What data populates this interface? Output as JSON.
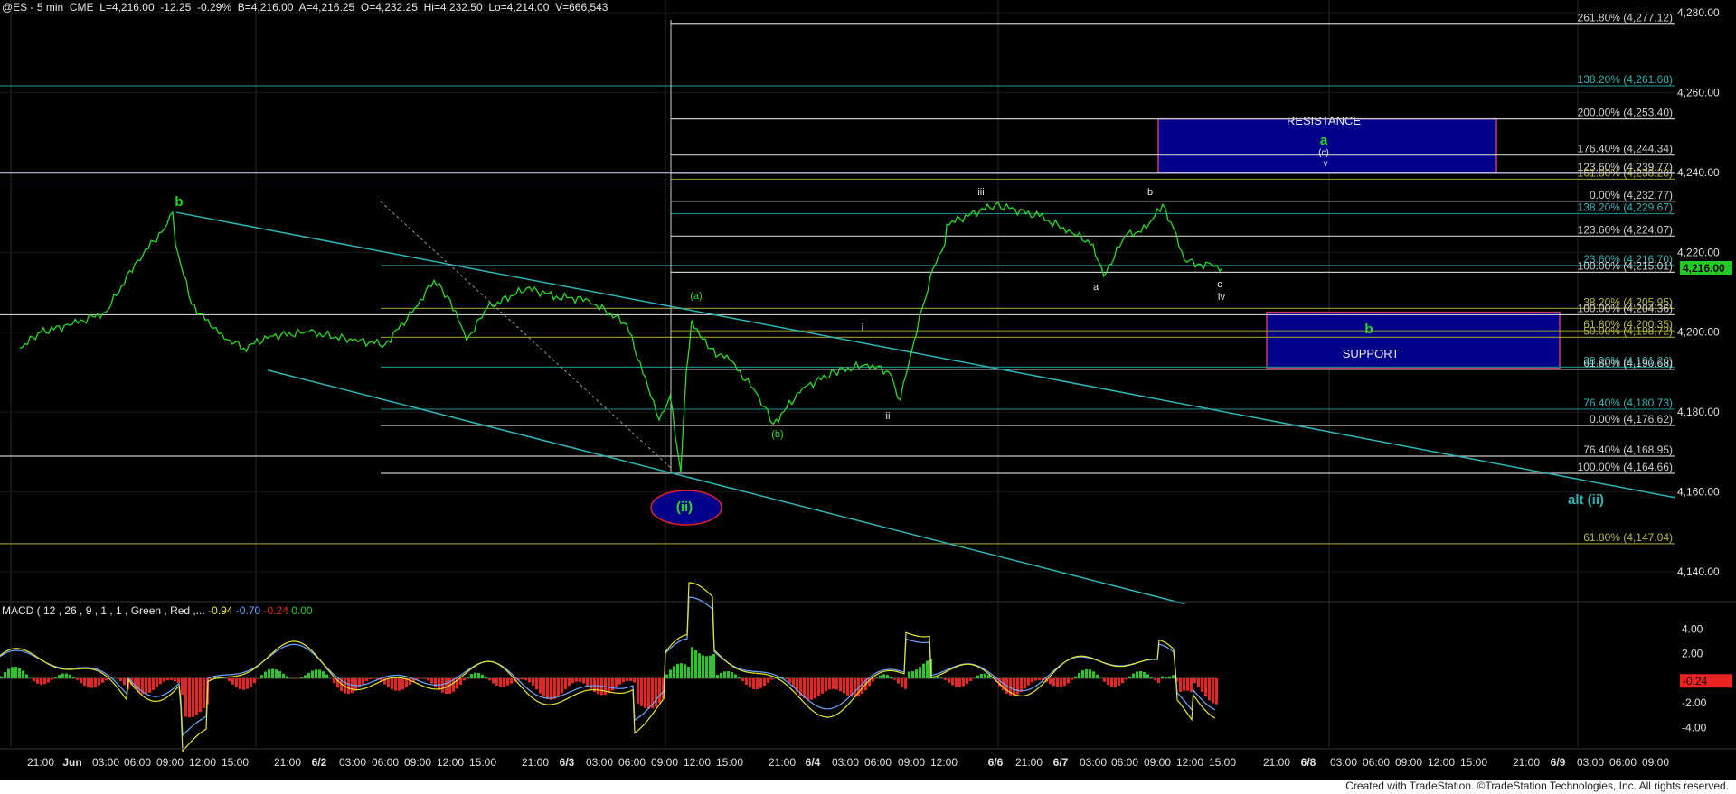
{
  "header": {
    "symbol": "@ES - 5 min",
    "exchange": "CME",
    "last": "L=4,216.00",
    "change": "-12.25",
    "change_pct": "-0.29%",
    "bid": "B=4,216.00",
    "ask": "A=4,216.25",
    "open": "O=4,232.25",
    "high": "Hi=4,232.50",
    "low": "Lo=4,214.00",
    "volume": "V=666,543"
  },
  "macd_header": {
    "label": "MACD ( 12 , 26 , 9 , 1 , 1 , Green , Red ,...",
    "v1": "-0.94",
    "v2": "-0.70",
    "v3": "-0.24",
    "v4": "0.00"
  },
  "last_price_tag": "4,216.00",
  "macd_value_tag": "-0.24",
  "footer": "Created with TradeStation. ©TradeStation Technologies, Inc. All rights reserved.",
  "zones": {
    "resistance": "RESISTANCE",
    "support": "SUPPORT"
  },
  "wave_labels": {
    "b_left": "b",
    "ii_circle": "(ii)",
    "a_paren": "(a)",
    "b_paren": "(b)",
    "i": "i",
    "ii": "ii",
    "iii": "iii",
    "a": "a",
    "b": "b",
    "c": "c",
    "iv": "iv",
    "a_green": "a",
    "c_paren": "(c)",
    "v": "v",
    "b_green": "b",
    "alt_ii": "alt (ii)"
  },
  "colors": {
    "price": "#22dd22",
    "trend": "#2fb5b5",
    "fib_white": "#d8d8d8",
    "fib_teal": "#2aa0a0",
    "fib_olive": "#9a9a3a",
    "zone": "#00008b",
    "macd_yellow": "#e6e62a",
    "macd_blue": "#6aa8ff",
    "hist_up": "#22cc22",
    "hist_down": "#ee2222"
  },
  "chart_data": {
    "type": "line",
    "series": [
      {
        "name": "@ES - 5 min",
        "points": [
          [
            "5/31 19:00",
            4196
          ],
          [
            "5/31 21:00",
            4200
          ],
          [
            "6/1 00:00",
            4202
          ],
          [
            "6/1 03:00",
            4205
          ],
          [
            "6/1 06:00",
            4218
          ],
          [
            "6/1 08:30",
            4226
          ],
          [
            "6/1 09:15",
            4230
          ],
          [
            "6/1 09:30",
            4222
          ],
          [
            "6/1 11:00",
            4207
          ],
          [
            "6/1 13:00",
            4201
          ],
          [
            "6/1 14:30",
            4198
          ],
          [
            "6/1 16:00",
            4196
          ],
          [
            "6/1 19:00",
            4199
          ],
          [
            "6/1 23:00",
            4200
          ],
          [
            "6/2 03:00",
            4198
          ],
          [
            "6/2 06:00",
            4197
          ],
          [
            "6/2 08:30",
            4205
          ],
          [
            "6/2 10:30",
            4213
          ],
          [
            "6/2 12:00",
            4208
          ],
          [
            "6/2 13:30",
            4198
          ],
          [
            "6/2 15:30",
            4206
          ],
          [
            "6/2 20:00",
            4211
          ],
          [
            "6/2 23:00",
            4209
          ],
          [
            "6/3 02:00",
            4208
          ],
          [
            "6/3 05:30",
            4202
          ],
          [
            "6/3 07:30",
            4186
          ],
          [
            "6/3 08:30",
            4178
          ],
          [
            "6/3 09:30",
            4184
          ],
          [
            "6/3 10:30",
            4165
          ],
          [
            "6/3 11:00",
            4190
          ],
          [
            "6/3 11:30",
            4203
          ],
          [
            "6/3 13:00",
            4196
          ],
          [
            "6/3 15:00",
            4193
          ],
          [
            "6/3 18:00",
            4185
          ],
          [
            "6/3 20:00",
            4177
          ],
          [
            "6/3 23:00",
            4186
          ],
          [
            "6/4 02:00",
            4190
          ],
          [
            "6/4 05:00",
            4192
          ],
          [
            "6/4 07:00",
            4190
          ],
          [
            "6/4 08:00",
            4183
          ],
          [
            "6/4 09:00",
            4195
          ],
          [
            "6/4 10:00",
            4206
          ],
          [
            "6/4 11:00",
            4216
          ],
          [
            "6/4 13:00",
            4222
          ],
          [
            "6/4 15:00",
            4227
          ],
          [
            "6/6 20:00",
            4232
          ],
          [
            "6/6 22:00",
            4229
          ],
          [
            "6/7 01:00",
            4225
          ],
          [
            "6/7 03:00",
            4222
          ],
          [
            "6/7 04:00",
            4214
          ],
          [
            "6/7 06:00",
            4224
          ],
          [
            "6/7 08:00",
            4226
          ],
          [
            "6/7 09:30",
            4232
          ],
          [
            "6/7 10:30",
            4226
          ],
          [
            "6/7 11:30",
            4218
          ],
          [
            "6/7 13:00",
            4217
          ],
          [
            "6/7 14:00",
            4217
          ],
          [
            "6/7 15:00",
            4216
          ]
        ]
      }
    ],
    "x_ticks": [
      "21:00",
      "Jun",
      "03:00",
      "06:00",
      "09:00",
      "12:00",
      "15:00",
      "21:00",
      "6/2",
      "03:00",
      "06:00",
      "09:00",
      "12:00",
      "15:00",
      "21:00",
      "6/3",
      "03:00",
      "06:00",
      "09:00",
      "12:00",
      "15:00",
      "21:00",
      "6/4",
      "03:00",
      "06:00",
      "09:00",
      "12:00",
      "6/6",
      "21:00",
      "6/7",
      "03:00",
      "06:00",
      "09:00",
      "12:00",
      "15:00",
      "21:00",
      "6/8",
      "03:00",
      "06:00",
      "09:00",
      "12:00",
      "15:00",
      "21:00",
      "6/9",
      "03:00",
      "06:00",
      "09:00"
    ],
    "y_ticks": [
      "4,280.00",
      "4,260.00",
      "4,240.00",
      "4,220.00",
      "4,200.00",
      "4,180.00",
      "4,160.00",
      "4,140.00"
    ],
    "ylim": [
      4133,
      4283
    ],
    "fib_levels": [
      {
        "label": "261.80% (4,277.12)",
        "value": 4277.12
      },
      {
        "label": "138.20% (4,261.68)",
        "value": 4261.68
      },
      {
        "label": "200.00% (4,253.40)",
        "value": 4253.4
      },
      {
        "label": "176.40% (4,244.34)",
        "value": 4244.34
      },
      {
        "label": "123.60% (4,239.77)",
        "value": 4239.77
      },
      {
        "label": "161.80% (4,238.28)",
        "value": 4238.28
      },
      {
        "label": "0.00% (4,232.77)",
        "value": 4232.77
      },
      {
        "label": "138.20% (4,229.67)",
        "value": 4229.67
      },
      {
        "label": "123.60% (4,224.07)",
        "value": 4224.07
      },
      {
        "label": "23.60% (4,216.70)",
        "value": 4216.7
      },
      {
        "label": "100.00% (4,215.01)",
        "value": 4215.01
      },
      {
        "label": "38.20% (4,205.95)",
        "value": 4205.95
      },
      {
        "label": "100.00% (4,204.36)",
        "value": 4204.36
      },
      {
        "label": "61.80% (4,200.35)",
        "value": 4200.35
      },
      {
        "label": "50.00% (4,198.72)",
        "value": 4198.72
      },
      {
        "label": "38.20% (4,191.26)",
        "value": 4191.26
      },
      {
        "label": "61.80% (4,190.68)",
        "value": 4190.68
      },
      {
        "label": "76.40% (4,180.73)",
        "value": 4180.73
      },
      {
        "label": "0.00% (4,176.62)",
        "value": 4176.62
      },
      {
        "label": "76.40% (4,168.95)",
        "value": 4168.95
      },
      {
        "label": "100.00% (4,164.66)",
        "value": 4164.66
      },
      {
        "label": "61.80% (4,147.04)",
        "value": 4147.04
      }
    ],
    "resistance_zone": [
      4240,
      4253.4
    ],
    "support_zone": [
      4191,
      4205
    ],
    "macd_y_ticks": [
      "4.00",
      "2.00",
      "-2.00",
      "-4.00"
    ],
    "macd_ylim": [
      -5.5,
      5.2
    ]
  }
}
